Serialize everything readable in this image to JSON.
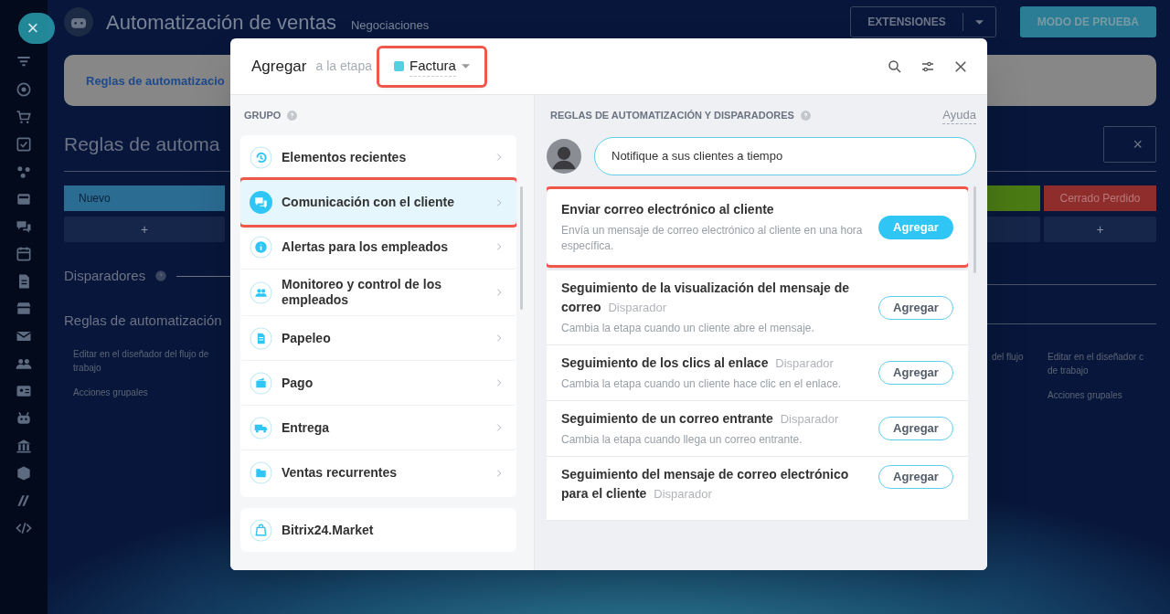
{
  "sidebar": {
    "close_label": "×"
  },
  "page": {
    "title": "Automatización de ventas",
    "subtitle": "Negociaciones",
    "extensions_button": "EXTENSIONES",
    "test_button": "MODO DE PRUEBA",
    "tab": "Reglas de automatizacio",
    "heading": "Reglas de automa",
    "stages_left": {
      "name": "Nuevo",
      "color": "#2b6c93",
      "add": "+"
    },
    "stages_right": [
      {
        "color": "#4a7a14"
      },
      {
        "name": "Cerrado Perdido",
        "color": "#8f2c2c",
        "add": "+"
      }
    ],
    "triggers_label": "Disparadores",
    "rules_label": "Reglas de automatización",
    "links_left": [
      "Editar en el diseñador del flujo de trabajo",
      "Acciones grupales"
    ],
    "links_right_cut": "del flujo",
    "links_right": [
      "Editar en el diseñador c de trabajo",
      "Acciones grupales"
    ],
    "search_clear": "×"
  },
  "dialog": {
    "title": "Agregar",
    "stage_prefix": "a la etapa",
    "stage": {
      "name": "Factura",
      "color": "#55d0e0",
      "highlighted": true
    },
    "group_heading": "GRUPO",
    "groups": [
      {
        "label": "Elementos recientes",
        "selected": false,
        "highlighted": false
      },
      {
        "label": "Comunicación con el cliente",
        "selected": true,
        "highlighted": true
      },
      {
        "label": "Alertas para los empleados",
        "selected": false,
        "highlighted": false
      },
      {
        "label": "Monitoreo y control de los empleados",
        "selected": false,
        "highlighted": false
      },
      {
        "label": "Papeleo",
        "selected": false,
        "highlighted": false
      },
      {
        "label": "Pago",
        "selected": false,
        "highlighted": false
      },
      {
        "label": "Entrega",
        "selected": false,
        "highlighted": false
      },
      {
        "label": "Ventas recurrentes",
        "selected": false,
        "highlighted": false
      }
    ],
    "market": {
      "label": "Bitrix24.Market"
    },
    "rules_heading": "REGLAS DE AUTOMATIZACIÓN Y DISPARADORES",
    "help": "Ayuda",
    "tip": "Notifique a sus clientes a tiempo",
    "rules": [
      {
        "title": "Enviar correo electrónico al cliente",
        "description": "Envía un mensaje de correo electrónico al cliente en una hora específica.",
        "button": "Agregar",
        "highlighted": true
      },
      {
        "title": "Seguimiento de la visualización del mensaje de correo",
        "tag": "Disparador",
        "description": "Cambia la etapa cuando un cliente abre el mensaje.",
        "button": "Agregar",
        "highlighted": false
      },
      {
        "title": "Seguimiento de los clics al enlace",
        "tag": "Disparador",
        "description": "Cambia la etapa cuando un cliente hace clic en el enlace.",
        "button": "Agregar",
        "highlighted": false
      },
      {
        "title": "Seguimiento de un correo entrante",
        "tag": "Disparador",
        "description": "Cambia la etapa cuando llega un correo entrante.",
        "button": "Agregar",
        "highlighted": false
      },
      {
        "title": "Seguimiento del mensaje de correo electrónico para el cliente",
        "tag": "Disparador",
        "button": "Agregar",
        "highlighted": false
      }
    ]
  }
}
